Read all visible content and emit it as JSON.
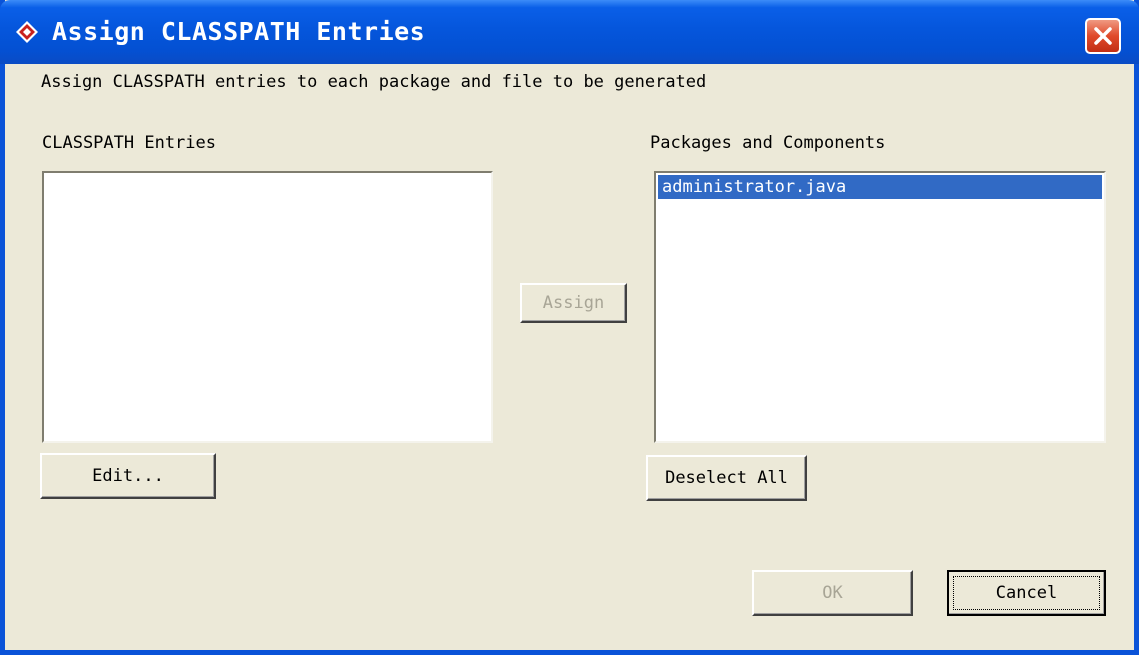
{
  "window": {
    "title": "Assign CLASSPATH Entries",
    "close_icon": "close-icon",
    "app_icon": "diamond-app-icon"
  },
  "instruction": "Assign CLASSPATH entries to each package and file to be generated",
  "classpath_entries": {
    "label": "CLASSPATH Entries",
    "items": [],
    "edit_label": "Edit..."
  },
  "assign_label": "Assign",
  "packages": {
    "label": "Packages and Components",
    "items": [
      "administrator.java"
    ],
    "selected_index": 0,
    "deselect_label": "Deselect All"
  },
  "footer": {
    "ok_label": "OK",
    "cancel_label": "Cancel"
  },
  "colors": {
    "titlebar": "#0556dc",
    "selection": "#316ac5",
    "dialog_bg": "#ece9d8",
    "close_button": "#e04a2a"
  }
}
